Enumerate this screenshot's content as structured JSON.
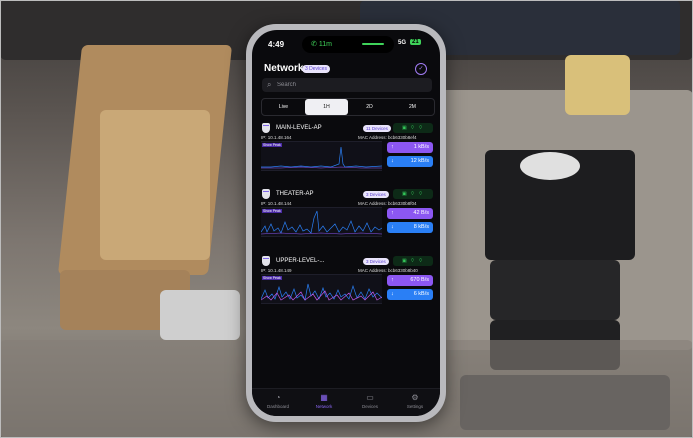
{
  "status": {
    "time": "4:49",
    "call": "11m",
    "signal": "5G",
    "battery": "21"
  },
  "header": {
    "title": "Network",
    "badge": "3 Devices"
  },
  "search": {
    "placeholder": "Search"
  },
  "tabs": [
    {
      "label": "Live",
      "active": false
    },
    {
      "label": "1H",
      "active": true
    },
    {
      "label": "2D",
      "active": false
    },
    {
      "label": "2M",
      "active": false
    }
  ],
  "aps": [
    {
      "name": "MAIN-LEVEL-AP",
      "devices": "11 Devices",
      "ip": "IP: 10.1.48.164",
      "mac": "MAC Address: bcb6330b8ef4",
      "label": "Show Peak",
      "up": "1 kB/s",
      "down": "12 kB/s"
    },
    {
      "name": "THEATER-AP",
      "devices": "3 Devices",
      "ip": "IP: 10.1.48.144",
      "mac": "MAC Address: bcb6330b8f04",
      "label": "Show Peak",
      "up": "42 B/s",
      "down": "8 kB/s"
    },
    {
      "name": "UPPER-LEVEL-...",
      "devices": "3 Devices",
      "ip": "IP: 10.1.48.149",
      "mac": "MAC Address: bcb6330b8b40",
      "label": "Show Peak",
      "up": "670 B/s",
      "down": "6 kB/s"
    }
  ],
  "nav": [
    {
      "label": "Dashboard",
      "icon": "gauge-icon",
      "active": false
    },
    {
      "label": "Network",
      "icon": "network-icon",
      "active": true
    },
    {
      "label": "Devices",
      "icon": "devices-icon",
      "active": false
    },
    {
      "label": "Settings",
      "icon": "gear-icon",
      "active": false
    }
  ],
  "colors": {
    "accent": "#8b67f2",
    "upload": "#8c57f2",
    "download": "#2a7ff5",
    "online": "#34c759"
  }
}
